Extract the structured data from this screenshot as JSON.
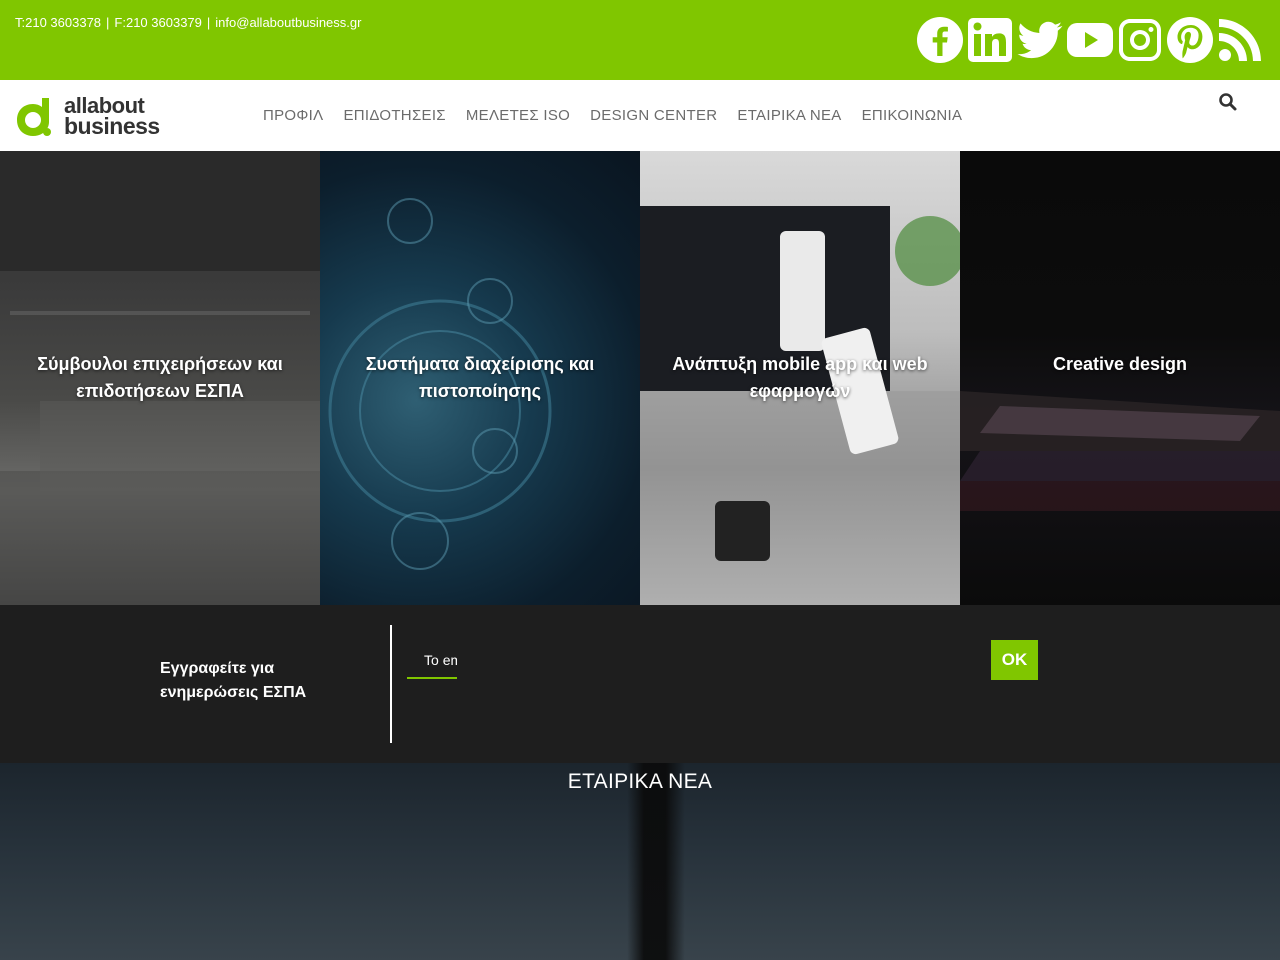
{
  "topbar": {
    "phone": "T:210 3603378",
    "fax": "F:210 3603379",
    "email": "info@allaboutbusiness.gr",
    "separator": "|",
    "social": [
      "facebook-icon",
      "linkedin-icon",
      "twitter-icon",
      "youtube-icon",
      "instagram-icon",
      "pinterest-icon",
      "rss-icon"
    ],
    "color": "#80c600"
  },
  "nav": {
    "logo_line1": "allabout",
    "logo_line2": "business",
    "items": [
      "ΠΡΟΦΙΛ",
      "ΕΠΙΔΟΤΗΣΕΙΣ",
      "ΜΕΛΕΤΕΣ ISO",
      "DESIGN CENTER",
      "ΕΤΑΙΡΙΚΑ ΝΕΑ",
      "ΕΠΙΚΟΙΝΩΝΙΑ"
    ]
  },
  "tiles": [
    {
      "caption": "Σύμβουλοι επιχειρήσεων και επιδοτήσεων ΕΣΠΑ"
    },
    {
      "caption": "Συστήματα διαχείρισης και πιστοποίησης"
    },
    {
      "caption": "Ανάπτυξη mobile app και web εφαρμογών"
    },
    {
      "caption": "Creative design"
    }
  ],
  "newsletter": {
    "label": "Εγγραφείτε για ενημερώσεις ΕΣΠΑ",
    "placeholder": "Το email σας",
    "submit": "OK"
  },
  "news": {
    "title": "ΕΤΑΙΡΙΚΑ ΝΕΑ"
  }
}
